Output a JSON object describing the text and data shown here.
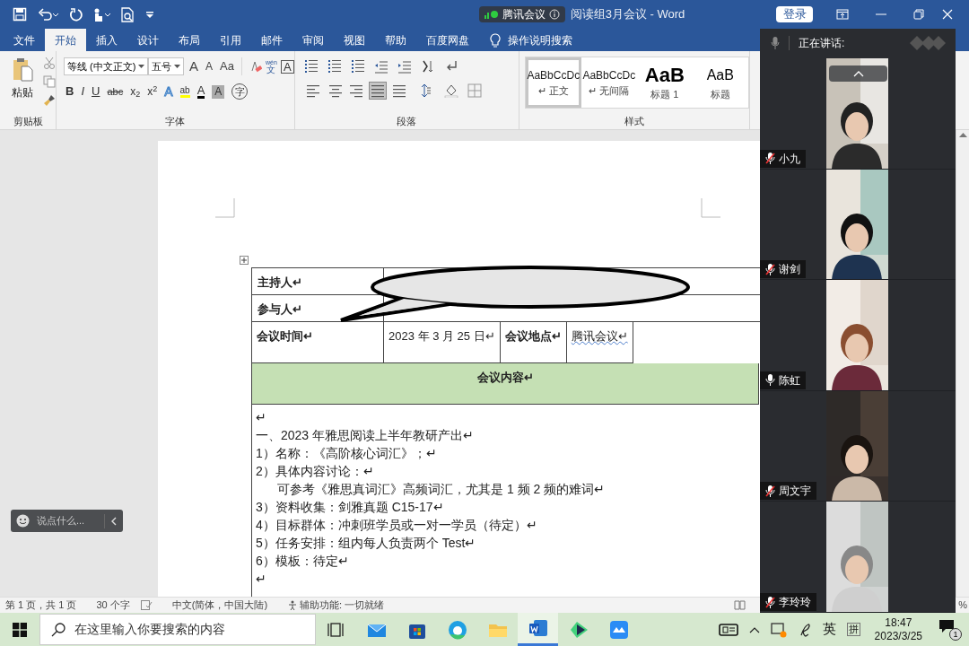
{
  "title_bar": {
    "meeting_badge": "腾讯会议",
    "title": "阅读组3月会议 - Word",
    "login": "登录"
  },
  "tabs": [
    {
      "label": "文件",
      "selected": false
    },
    {
      "label": "开始",
      "selected": true
    },
    {
      "label": "插入",
      "selected": false
    },
    {
      "label": "设计",
      "selected": false
    },
    {
      "label": "布局",
      "selected": false
    },
    {
      "label": "引用",
      "selected": false
    },
    {
      "label": "邮件",
      "selected": false
    },
    {
      "label": "审阅",
      "selected": false
    },
    {
      "label": "视图",
      "selected": false
    },
    {
      "label": "帮助",
      "selected": false
    },
    {
      "label": "百度网盘",
      "selected": false
    }
  ],
  "tell_me": "操作说明搜索",
  "clipboard": {
    "paste": "粘贴",
    "group": "剪贴板"
  },
  "font": {
    "group": "字体",
    "family": "等线 (中文正文)",
    "size": "五号",
    "top_tools": [
      {
        "kind": "grow",
        "text": "A"
      },
      {
        "kind": "shrink",
        "text": "A"
      },
      {
        "kind": "case",
        "text": "Aa"
      },
      {
        "kind": "clear"
      },
      {
        "kind": "phonetic",
        "ruby": "wén",
        "text": "文"
      },
      {
        "kind": "border",
        "text": "A"
      }
    ],
    "bottom_tools": [
      {
        "kind": "bold",
        "text": "B"
      },
      {
        "kind": "italic",
        "text": "I"
      },
      {
        "kind": "underline",
        "text": "U"
      },
      {
        "kind": "strike",
        "text": "abc"
      },
      {
        "kind": "sub",
        "text": "x$_{2}$"
      },
      {
        "kind": "sup",
        "text": "x$^{2}$"
      },
      {
        "kind": "effect",
        "text": "A"
      },
      {
        "kind": "highlight",
        "text": "ab"
      },
      {
        "kind": "color",
        "text": "A"
      },
      {
        "kind": "shade",
        "text": "A"
      },
      {
        "kind": "enclose",
        "text": "字"
      }
    ]
  },
  "paragraph": {
    "group": "段落",
    "align": [
      {
        "kind": "left",
        "selected": false
      },
      {
        "kind": "center",
        "selected": false
      },
      {
        "kind": "right",
        "selected": false
      },
      {
        "kind": "justify",
        "selected": true
      },
      {
        "kind": "distributed",
        "selected": false
      }
    ]
  },
  "styles": {
    "group": "样式",
    "items": [
      {
        "kind": "body",
        "preview": "AaBbCcDc",
        "name": "↵ 正文",
        "selected": true
      },
      {
        "kind": "body",
        "preview": "AaBbCcDc",
        "name": "↵ 无间隔",
        "selected": false
      },
      {
        "kind": "heading",
        "preview": "AaB",
        "name": "标题 1",
        "selected": false
      },
      {
        "kind": "heading2",
        "preview": "AaB",
        "name": "标题",
        "selected": false
      }
    ]
  },
  "document": {
    "table": {
      "rows": [
        {
          "kind": "label",
          "label": "主持人↵"
        },
        {
          "kind": "label",
          "label": "参与人↵"
        },
        {
          "kind": "grid",
          "cells": [
            "会议时间↵",
            "2023 年 3 月 25 日↵",
            "会议地点↵",
            "腾讯会议↵"
          ]
        },
        {
          "kind": "header",
          "label": "会议内容↵"
        }
      ],
      "content": [
        {
          "kind": "line",
          "text": "↵"
        },
        {
          "kind": "line",
          "text": "一、2023 年雅思阅读上半年教研产出↵"
        },
        {
          "kind": "line",
          "text": "1）名称：《高阶核心词汇》；↵"
        },
        {
          "kind": "line",
          "text": "2）具体内容讨论：↵"
        },
        {
          "kind": "sub",
          "text": "可参考《雅思真词汇》高频词汇，尤其是 1 频 2 频的难词↵"
        },
        {
          "kind": "line",
          "text": "3）资料收集：剑雅真题 C15-17↵"
        },
        {
          "kind": "line",
          "text": "4）目标群体：冲刺班学员或一对一学员（待定）↵"
        },
        {
          "kind": "line",
          "text": "5）任务安排：组内每人负责两个 Test↵"
        },
        {
          "kind": "line",
          "text": "6）模板：待定↵"
        },
        {
          "kind": "line",
          "text": "↵"
        }
      ]
    }
  },
  "comment_bar": {
    "placeholder": "说点什么..."
  },
  "video_panel": {
    "header": "正在讲话:",
    "participants": [
      {
        "name": "小九",
        "muted": true
      },
      {
        "name": "谢剑",
        "muted": true
      },
      {
        "name": "陈虹",
        "muted": false
      },
      {
        "name": "周文宇",
        "muted": true
      },
      {
        "name": "李玲玲",
        "muted": true
      }
    ]
  },
  "status_bar": {
    "page": "第 1 页，共 1 页",
    "words": "30 个字",
    "language": "中文(简体，中国大陆)",
    "accessibility": "辅助功能: 一切就绪",
    "zoom": "%"
  },
  "taskbar": {
    "search_placeholder": "在这里输入你要搜索的内容",
    "ime_lang": "英",
    "ime_mode": "拼",
    "time": "18:47",
    "date": "2023/3/25",
    "notifications": "1"
  }
}
